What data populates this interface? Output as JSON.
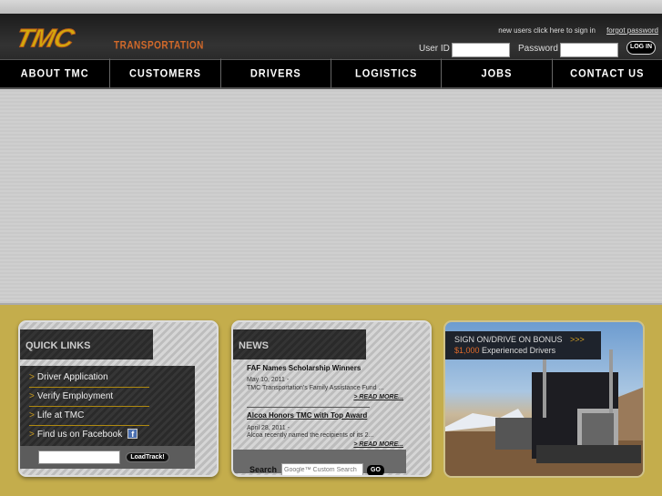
{
  "header": {
    "logo": "TMC",
    "logo_sub": "TRANSPORTATION",
    "signin_link": "new users click here to sign in",
    "forgot_link": "forgot password",
    "userid_label": "User ID",
    "userid_value": "",
    "password_label": "Password",
    "password_value": "",
    "login_button": "LOG IN"
  },
  "nav": [
    "ABOUT TMC",
    "CUSTOMERS",
    "DRIVERS",
    "LOGISTICS",
    "JOBS",
    "CONTACT US"
  ],
  "quick_links": {
    "title": "QUICK LINKS",
    "items": [
      "Driver Application",
      "Verify Employment",
      "Life at TMC",
      "Find us on Facebook"
    ],
    "bullet": ">",
    "facebook_icon": "f",
    "loadtrack_value": "",
    "loadtrack_button": "LoadTrack!"
  },
  "news": {
    "title": "NEWS",
    "items": [
      {
        "headline": "FAF Names Scholarship Winners",
        "date": "May 10, 2011  -",
        "summary": "TMC Transportation's Family Assistance Fund ...",
        "more": "> READ MORE..."
      },
      {
        "headline": "Alcoa Honors TMC with Top Award",
        "date": "April 28, 2011  -",
        "summary": "Alcoa recently named the recipients of its 2...",
        "more": "> READ MORE..."
      }
    ],
    "search_label": "Search",
    "search_placeholder": "Google™ Custom Search",
    "go_button": "GO"
  },
  "promo": {
    "line1": "SIGN ON/DRIVE ON BONUS",
    "arrows": ">>>",
    "amount": "$1,000",
    "line2": "Experienced Drivers"
  }
}
